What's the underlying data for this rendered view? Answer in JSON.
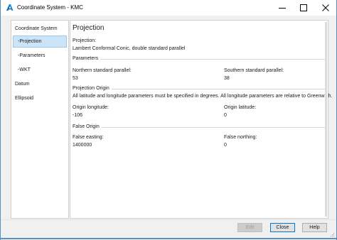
{
  "window": {
    "title": "Coordinate System - KMC",
    "accent": "#0078d7",
    "border_color": "#5a8fc4"
  },
  "icons": {
    "app": "autodesk-a-icon",
    "minimize": "minimize-icon",
    "maximize": "maximize-icon",
    "close": "close-icon",
    "resize": "resize-grip-icon"
  },
  "sidebar": {
    "items": [
      {
        "label": "Coordinate System",
        "selected": false
      },
      {
        "label": "-Projection",
        "selected": true
      },
      {
        "label": "-Parameters",
        "selected": false
      },
      {
        "label": "-WKT",
        "selected": false
      },
      {
        "label": "Datum",
        "selected": false
      },
      {
        "label": "Ellipsoid",
        "selected": false
      }
    ]
  },
  "content": {
    "title": "Projection",
    "projection": {
      "label": "Projection:",
      "value": "Lambert Conformal Conic, double standard parallel"
    },
    "parameters": {
      "heading": "Parameters",
      "northern_label": "Northern standard parallel:",
      "northern_value": "53",
      "southern_label": "Southern standard parallel:",
      "southern_value": "38"
    },
    "projection_origin": {
      "heading": "Projection Origin",
      "note": "All latitude and longitude parameters must be specified in degrees. All longitude parameters are relative to Greenwich.",
      "longitude_label": "Origin longitude:",
      "longitude_value": "-106",
      "latitude_label": "Origin latitude:",
      "latitude_value": "0"
    },
    "false_origin": {
      "heading": "False Origin",
      "easting_label": "False easting:",
      "easting_value": "1400000",
      "northing_label": "False northing:",
      "northing_value": "0"
    }
  },
  "footer": {
    "edit_label": "Edit",
    "close_label": "Close",
    "help_label": "Help"
  }
}
